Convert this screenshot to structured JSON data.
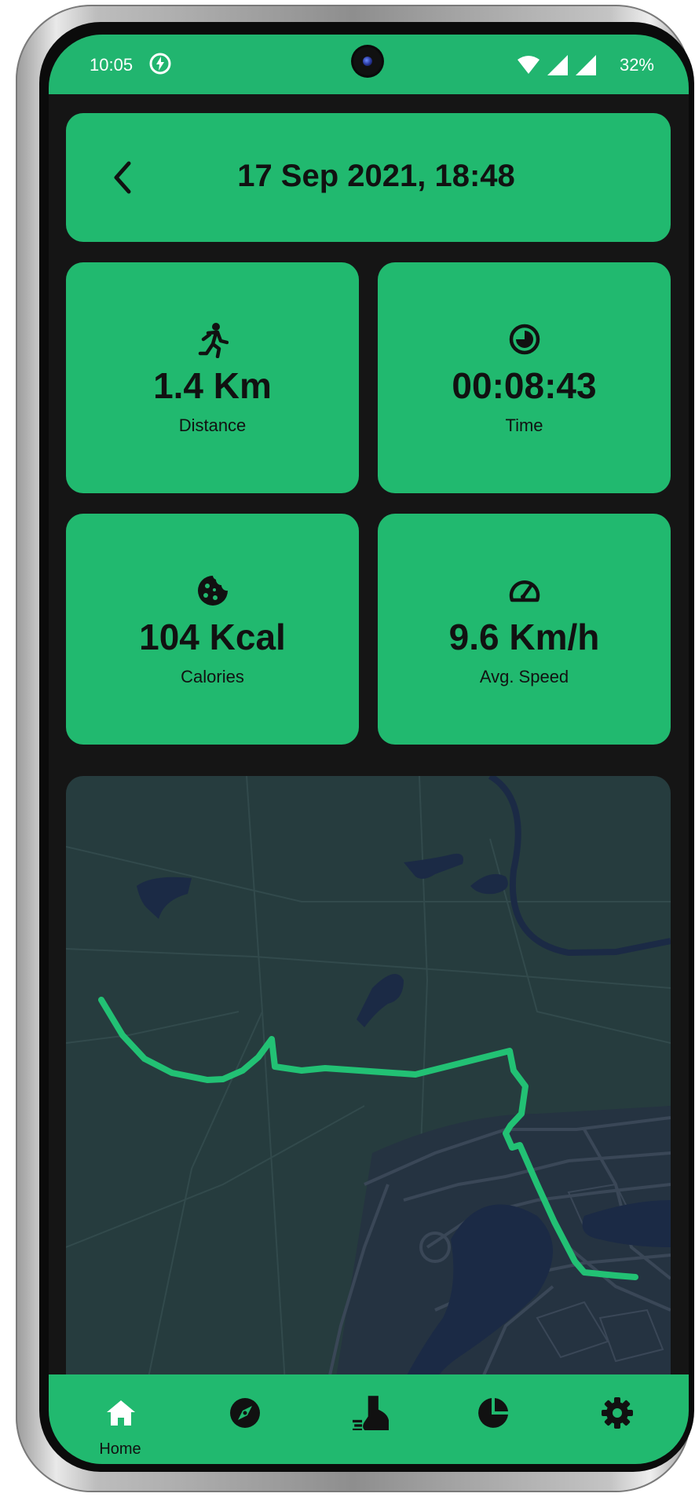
{
  "status_bar": {
    "time": "10:05",
    "battery": "32%",
    "icons": [
      "charging-bolt-icon",
      "wifi-icon",
      "signal-icon",
      "signal-icon"
    ]
  },
  "header": {
    "title": "17 Sep 2021, 18:48",
    "back_icon": "chevron-left-icon"
  },
  "stats": [
    {
      "icon": "running-person-icon",
      "value": "1.4 Km",
      "label": "Distance"
    },
    {
      "icon": "timer-icon",
      "value": "00:08:43",
      "label": "Time"
    },
    {
      "icon": "cookie-icon",
      "value": "104 Kcal",
      "label": "Calories"
    },
    {
      "icon": "speedometer-icon",
      "value": "9.6 Km/h",
      "label": "Avg. Speed"
    }
  ],
  "map": {
    "route_color": "#22c174",
    "style": "dark"
  },
  "bottom_nav": {
    "items": [
      {
        "icon": "home-icon",
        "label": "Home",
        "active": true
      },
      {
        "icon": "compass-icon",
        "label": ""
      },
      {
        "icon": "shoe-icon",
        "label": ""
      },
      {
        "icon": "pie-chart-icon",
        "label": ""
      },
      {
        "icon": "gear-icon",
        "label": ""
      }
    ]
  },
  "colors": {
    "accent": "#21b96f",
    "background": "#151515",
    "map_background": "#263c3e",
    "water": "#1b2a45"
  }
}
